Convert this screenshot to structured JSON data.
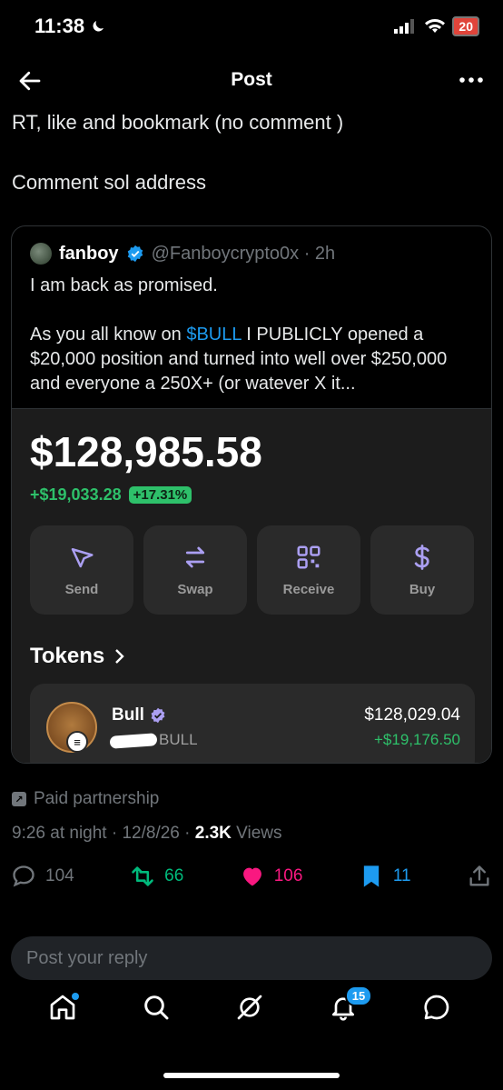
{
  "status_bar": {
    "time": "11:38",
    "battery": "20"
  },
  "header": {
    "title": "Post"
  },
  "post": {
    "line1": "RT, like and bookmark (no comment )",
    "line2": "Comment sol address"
  },
  "quote": {
    "name": "fanboy",
    "handle": "@Fanboycrypto0x · 2h",
    "text_line1": "I am back as promised.",
    "text_pre": "As you all know on ",
    "cashtag": "$BULL",
    "text_post": " I PUBLICLY opened a $20,000 position and turned into well over $250,000 and everyone a 250X+ (or watever X it..."
  },
  "wallet": {
    "balance": "$128,985.58",
    "gain": "+$19,033.28",
    "gain_pct": "+17.31%",
    "actions": [
      {
        "label": "Send",
        "icon": "send-icon"
      },
      {
        "label": "Swap",
        "icon": "swap-icon"
      },
      {
        "label": "Receive",
        "icon": "qr-icon"
      },
      {
        "label": "Buy",
        "icon": "dollar-icon"
      }
    ],
    "tokens_title": "Tokens",
    "token": {
      "name": "Bull",
      "symbol": "BULL",
      "value": "$128,029.04",
      "change": "+$19,176.50"
    },
    "accent": "#ab9ff2",
    "positive": "#2ec06a"
  },
  "post_meta": {
    "paid": "Paid partnership",
    "time": "9:26 at night · 12/8/26 · ",
    "views_count": "2.3K",
    "views_label": " Views"
  },
  "stats": {
    "replies": "104",
    "reposts": "66",
    "likes": "106",
    "bookmarks": "11"
  },
  "reply": {
    "placeholder": "Post your reply"
  },
  "nav": {
    "notifications_badge": "15"
  }
}
